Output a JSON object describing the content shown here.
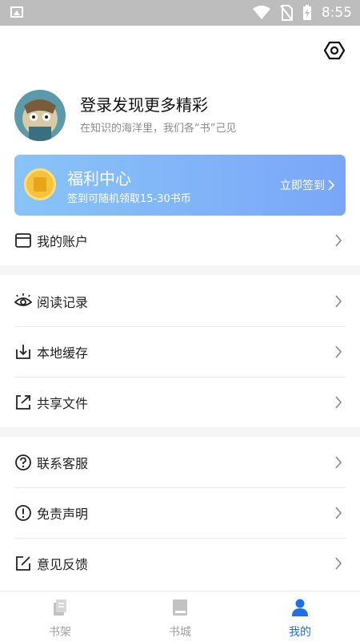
{
  "status_bar": {
    "time": "8:55"
  },
  "profile": {
    "title": "登录发现更多精彩",
    "subtitle": "在知识的海洋里，我们各“书”己见"
  },
  "welfare": {
    "title": "福利中心",
    "subtitle": "签到可随机领取15-30书币",
    "action": "立即签到"
  },
  "menu": {
    "account": "我的账户",
    "reading_history": "阅读记录",
    "local_cache": "本地缓存",
    "shared_files": "共享文件",
    "customer_service": "联系客服",
    "disclaimer": "免责声明",
    "feedback": "意见反馈"
  },
  "tabs": {
    "bookshelf": "书架",
    "bookstore": "书城",
    "mine": "我的"
  },
  "colors": {
    "accent": "#1e70e6",
    "banner_start": "#88c4f8",
    "banner_end": "#7aa6f8",
    "coin": "#f6c340"
  }
}
